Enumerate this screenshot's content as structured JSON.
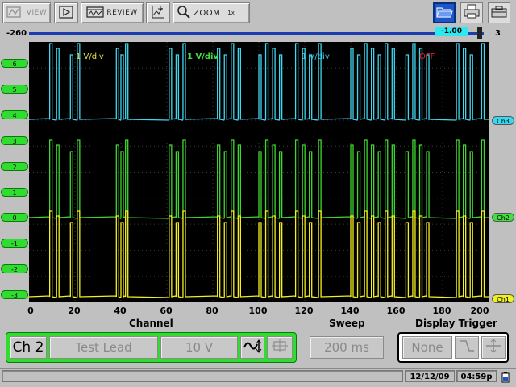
{
  "toolbar": {
    "view_label": "VIEW",
    "review_label": "REVIEW",
    "zoom_label": "ZOOM",
    "zoom_level": "1x"
  },
  "cursor_bar": {
    "left_value": "-260",
    "cursor_value": "-1.00",
    "right_value": "3"
  },
  "scope": {
    "y_labels": [
      "6",
      "5",
      "4",
      "3",
      "2",
      "1",
      "0",
      "-1",
      "-2",
      "-3"
    ],
    "x_labels": [
      "0",
      "20",
      "40",
      "60",
      "80",
      "100",
      "120",
      "140",
      "160",
      "180",
      "200"
    ],
    "channel_annotations": [
      {
        "text": "1 V/div",
        "color": "#e8e050"
      },
      {
        "text": "1 V/div",
        "color": "#40e040"
      },
      {
        "text": "1 V/div",
        "color": "#38c8e8"
      },
      {
        "text": "OFF",
        "color": "#e82020"
      }
    ],
    "markers": [
      {
        "label": "Ch3",
        "color": "#38d8f0"
      },
      {
        "label": "Ch2",
        "color": "#40e040"
      },
      {
        "label": "Ch1",
        "color": "#f0f020"
      }
    ],
    "trace_colors": {
      "ch1": "#f5f020",
      "ch2": "#40d830",
      "ch3": "#40d8f0"
    }
  },
  "sections": {
    "channel": "Channel",
    "sweep": "Sweep",
    "display_trigger": "Display Trigger"
  },
  "controls": {
    "channel_select": "Ch 2",
    "lead": "Test Lead",
    "voltage": "10 V",
    "sweep": "200 ms",
    "trigger": "None"
  },
  "status": {
    "date": "12/12/09",
    "time": "04:59p"
  },
  "colors": {
    "accent_green": "#2fdc2f",
    "scope_bg": "#000000",
    "active_button": "#1c56c8"
  }
}
